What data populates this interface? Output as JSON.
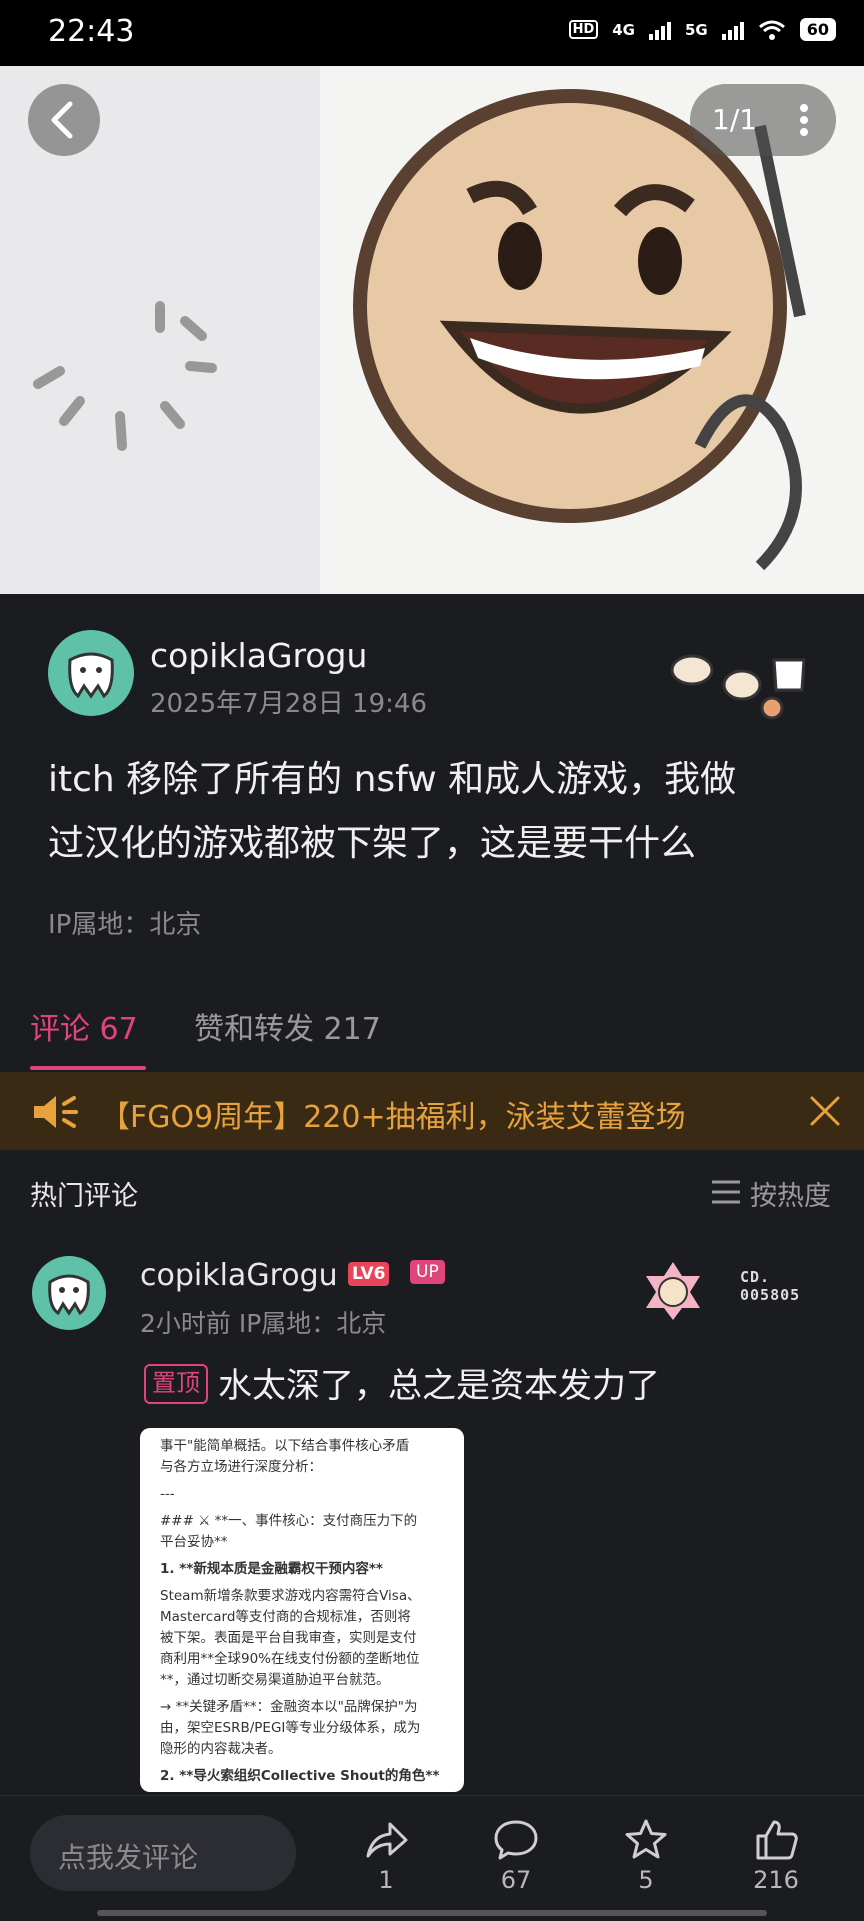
{
  "status_bar": {
    "time": "22:43",
    "hd": "HD",
    "net1": "4G",
    "net2": "5G",
    "battery": "60"
  },
  "image_viewer": {
    "page_indicator": "1/1"
  },
  "post": {
    "author": "copiklaGrogu",
    "date": "2025年7月28日 19:46",
    "text_line1": "itch 移除了所有的 nsfw 和成人游戏，我做",
    "text_line2": "过汉化的游戏都被下架了，这是要干什么",
    "ip": "IP属地：北京"
  },
  "tabs": {
    "comments": "评论 67",
    "likes_reposts": "赞和转发 217"
  },
  "banner": {
    "text": "【FGO9周年】220+抽福利，泳装艾蕾登场"
  },
  "hot_comments": {
    "title": "热门评论",
    "sort_label": "按热度",
    "comment": {
      "author": "copiklaGrogu",
      "level": "LV6",
      "up_badge": "UP",
      "meta": "2小时前 IP属地：北京",
      "cd_label": "CD.",
      "cd_number": "005805",
      "pinned": "置顶",
      "text": "水太深了，总之是资本发力了",
      "image_lines": [
        "事干\"能简单概括。以下结合事件核心矛盾",
        "与各方立场进行深度分析：",
        "---",
        "### ⚔ **一、事件核心：支付商压力下的",
        "平台妥协**",
        "1. **新规本质是金融霸权干预内容**",
        "Steam新增条款要求游戏内容需符合Visa、",
        "Mastercard等支付商的合规标准，否则将",
        "被下架。表面是平台自我审查，实则是支付",
        "商利用**全球90%在线支付份额的垄断地位",
        "**，通过切断交易渠道胁迫平台就范。",
        "→ **关键矛盾**：金融资本以\"品牌保护\"为",
        "由，架空ESRB/PEGI等专业分级体系，成为",
        "隐形的内容裁决者。",
        "2. **导火索组织Collective Shout的角色**"
      ]
    }
  },
  "bottom_bar": {
    "input_placeholder": "点我发评论",
    "share_count": "1",
    "comment_count": "67",
    "star_count": "5",
    "like_count": "216"
  }
}
